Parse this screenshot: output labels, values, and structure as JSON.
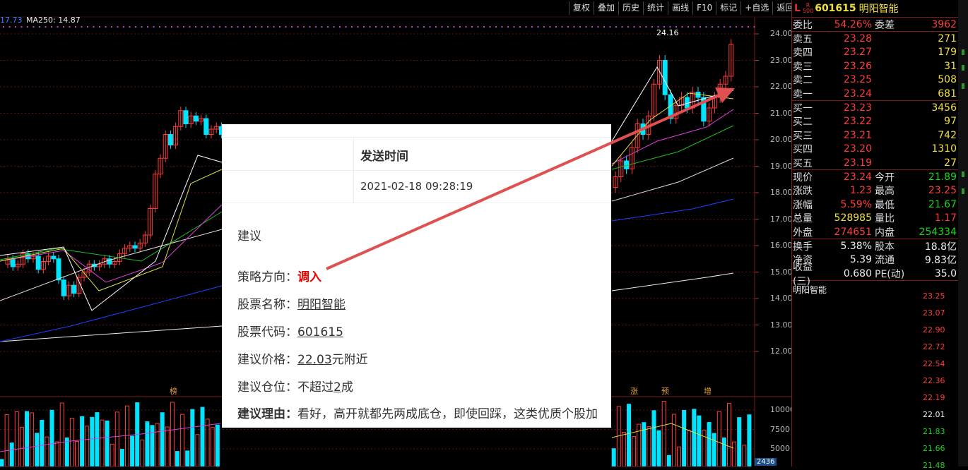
{
  "toolbar": [
    "复权",
    "叠加",
    "历史",
    "统计",
    "画线",
    "F10",
    "标记",
    "+自选",
    "返回"
  ],
  "ma_text": {
    "prefix": "17.73",
    "ma250": "MA250: 14.87"
  },
  "price_axis": [
    "24.00",
    "23.00",
    "22.00",
    "21.00",
    "20.00",
    "19.00",
    "18.00",
    "17.00",
    "16.00",
    "15.00",
    "14.00",
    "13.00",
    "12.00"
  ],
  "volume_axis": [
    "10000",
    "7500",
    "5000"
  ],
  "peak_label": "24.16",
  "markers": [
    "榜",
    "涨",
    "预",
    "增"
  ],
  "volume_current": "2436",
  "quote": {
    "L": "L",
    "R": "R",
    "sub": "500",
    "code": "601615",
    "name": "明阳智能",
    "weibi_label": "委比",
    "weibi": "54.26%",
    "weicha_label": "委差",
    "weicha": "3962",
    "asks": [
      {
        "label": "卖五",
        "price": "23.28",
        "vol": "271"
      },
      {
        "label": "卖四",
        "price": "23.27",
        "vol": "179"
      },
      {
        "label": "卖三",
        "price": "23.26",
        "vol": "31"
      },
      {
        "label": "卖二",
        "price": "23.25",
        "vol": "508"
      },
      {
        "label": "卖一",
        "price": "23.24",
        "vol": "681"
      }
    ],
    "bids": [
      {
        "label": "买一",
        "price": "23.23",
        "vol": "3456"
      },
      {
        "label": "买二",
        "price": "23.22",
        "vol": "97"
      },
      {
        "label": "买三",
        "price": "23.21",
        "vol": "742"
      },
      {
        "label": "买四",
        "price": "23.20",
        "vol": "1310"
      },
      {
        "label": "买五",
        "price": "23.19",
        "vol": "27"
      }
    ],
    "stats": [
      {
        "l1": "现价",
        "v1": "23.24",
        "c1": "red",
        "l2": "今开",
        "v2": "21.89",
        "c2": "grn"
      },
      {
        "l1": "涨跌",
        "v1": "1.23",
        "c1": "red",
        "l2": "最高",
        "v2": "23.25",
        "c2": "red"
      },
      {
        "l1": "涨幅",
        "v1": "5.59%",
        "c1": "red",
        "l2": "最低",
        "v2": "21.67",
        "c2": "grn"
      },
      {
        "l1": "总量",
        "v1": "528985",
        "c1": "yel",
        "l2": "量比",
        "v2": "1.17",
        "c2": "red"
      },
      {
        "l1": "外盘",
        "v1": "274651",
        "c1": "red",
        "l2": "内盘",
        "v2": "254334",
        "c2": "grn"
      }
    ],
    "stats2": [
      {
        "l1": "换手",
        "v1": "5.38%",
        "l2": "股本",
        "v2": "18.8亿"
      },
      {
        "l1": "净资",
        "v1": "5.39",
        "l2": "流通",
        "v2": "9.83亿"
      },
      {
        "l1": "收益(三)",
        "v1": "0.680",
        "l2": "PE(动)",
        "v2": "35.0"
      }
    ]
  },
  "mini_chart": {
    "title": "明阳智能",
    "axis": [
      {
        "v": "23.25",
        "c": "red"
      },
      {
        "v": "23.07",
        "c": "red"
      },
      {
        "v": "22.90",
        "c": "red"
      },
      {
        "v": "22.72",
        "c": "red"
      },
      {
        "v": "22.54",
        "c": "red"
      },
      {
        "v": "22.36",
        "c": "red"
      },
      {
        "v": "22.19",
        "c": "red"
      },
      {
        "v": "22.01",
        "c": "wht"
      },
      {
        "v": "21.83",
        "c": "grn"
      },
      {
        "v": "21.66",
        "c": "grn"
      },
      {
        "v": "21.48",
        "c": "grn"
      }
    ]
  },
  "popup": {
    "header": "发送时间",
    "time": "2021-02-18 09:28:19",
    "title": "建议",
    "direction_label": "策略方向：",
    "direction": "调入",
    "name_label": "股票名称：",
    "name": "明阳智能",
    "code_label": "股票代码：",
    "code": "601615",
    "price_label": "建议价格：",
    "price": "22.03",
    "price_suffix": "元附近",
    "position_label": "建议仓位：",
    "position_pre": "不超过",
    "position_num": "2",
    "position_suffix": "成",
    "reason_label": "建议理由：",
    "reason": "看好，高开就都先两成底仓，即使回踩，这类优质个股加"
  },
  "colors": {
    "up": "#ff3b3b",
    "down": "#00e5ff",
    "grid": "#5a1212",
    "arrow": "#e05050"
  }
}
